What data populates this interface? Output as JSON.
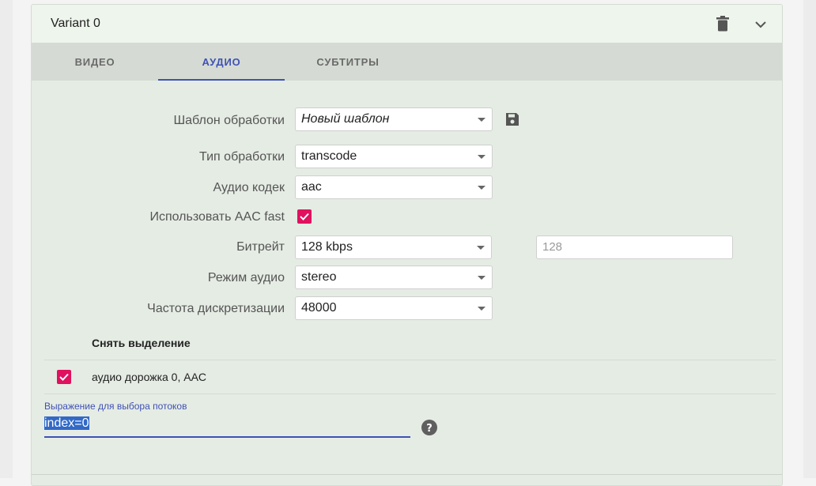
{
  "variant": {
    "title": "Variant 0"
  },
  "tabs": [
    {
      "label": "ВИДЕО",
      "active": false
    },
    {
      "label": "АУДИО",
      "active": true
    },
    {
      "label": "СУБТИТРЫ",
      "active": false
    }
  ],
  "form": {
    "template": {
      "label": "Шаблон обработки",
      "value": "Новый шаблон"
    },
    "processing_type": {
      "label": "Тип обработки",
      "value": "transcode"
    },
    "audio_codec": {
      "label": "Аудио кодек",
      "value": "aac"
    },
    "aac_fast": {
      "label": "Использовать AAC fast",
      "checked": true
    },
    "bitrate": {
      "label": "Битрейт",
      "value": "128 kbps",
      "custom_placeholder": "128"
    },
    "audio_mode": {
      "label": "Режим аудио",
      "value": "stereo"
    },
    "sample_rate": {
      "label": "Частота дискретизации",
      "value": "48000"
    }
  },
  "tracks": {
    "deselect_label": "Снять выделение",
    "items": [
      {
        "label": "аудио дорожка 0, AAC",
        "checked": true
      }
    ]
  },
  "expression": {
    "label": "Выражение для выбора потоков",
    "value": "index=0"
  },
  "colors": {
    "accent": "#3f51b5",
    "checkbox": "#e0115f",
    "card_bg": "#e5ece4"
  },
  "icons": {
    "delete": "trash-icon",
    "collapse": "chevron-down-icon",
    "save": "save-icon",
    "help": "help-circle-icon"
  }
}
